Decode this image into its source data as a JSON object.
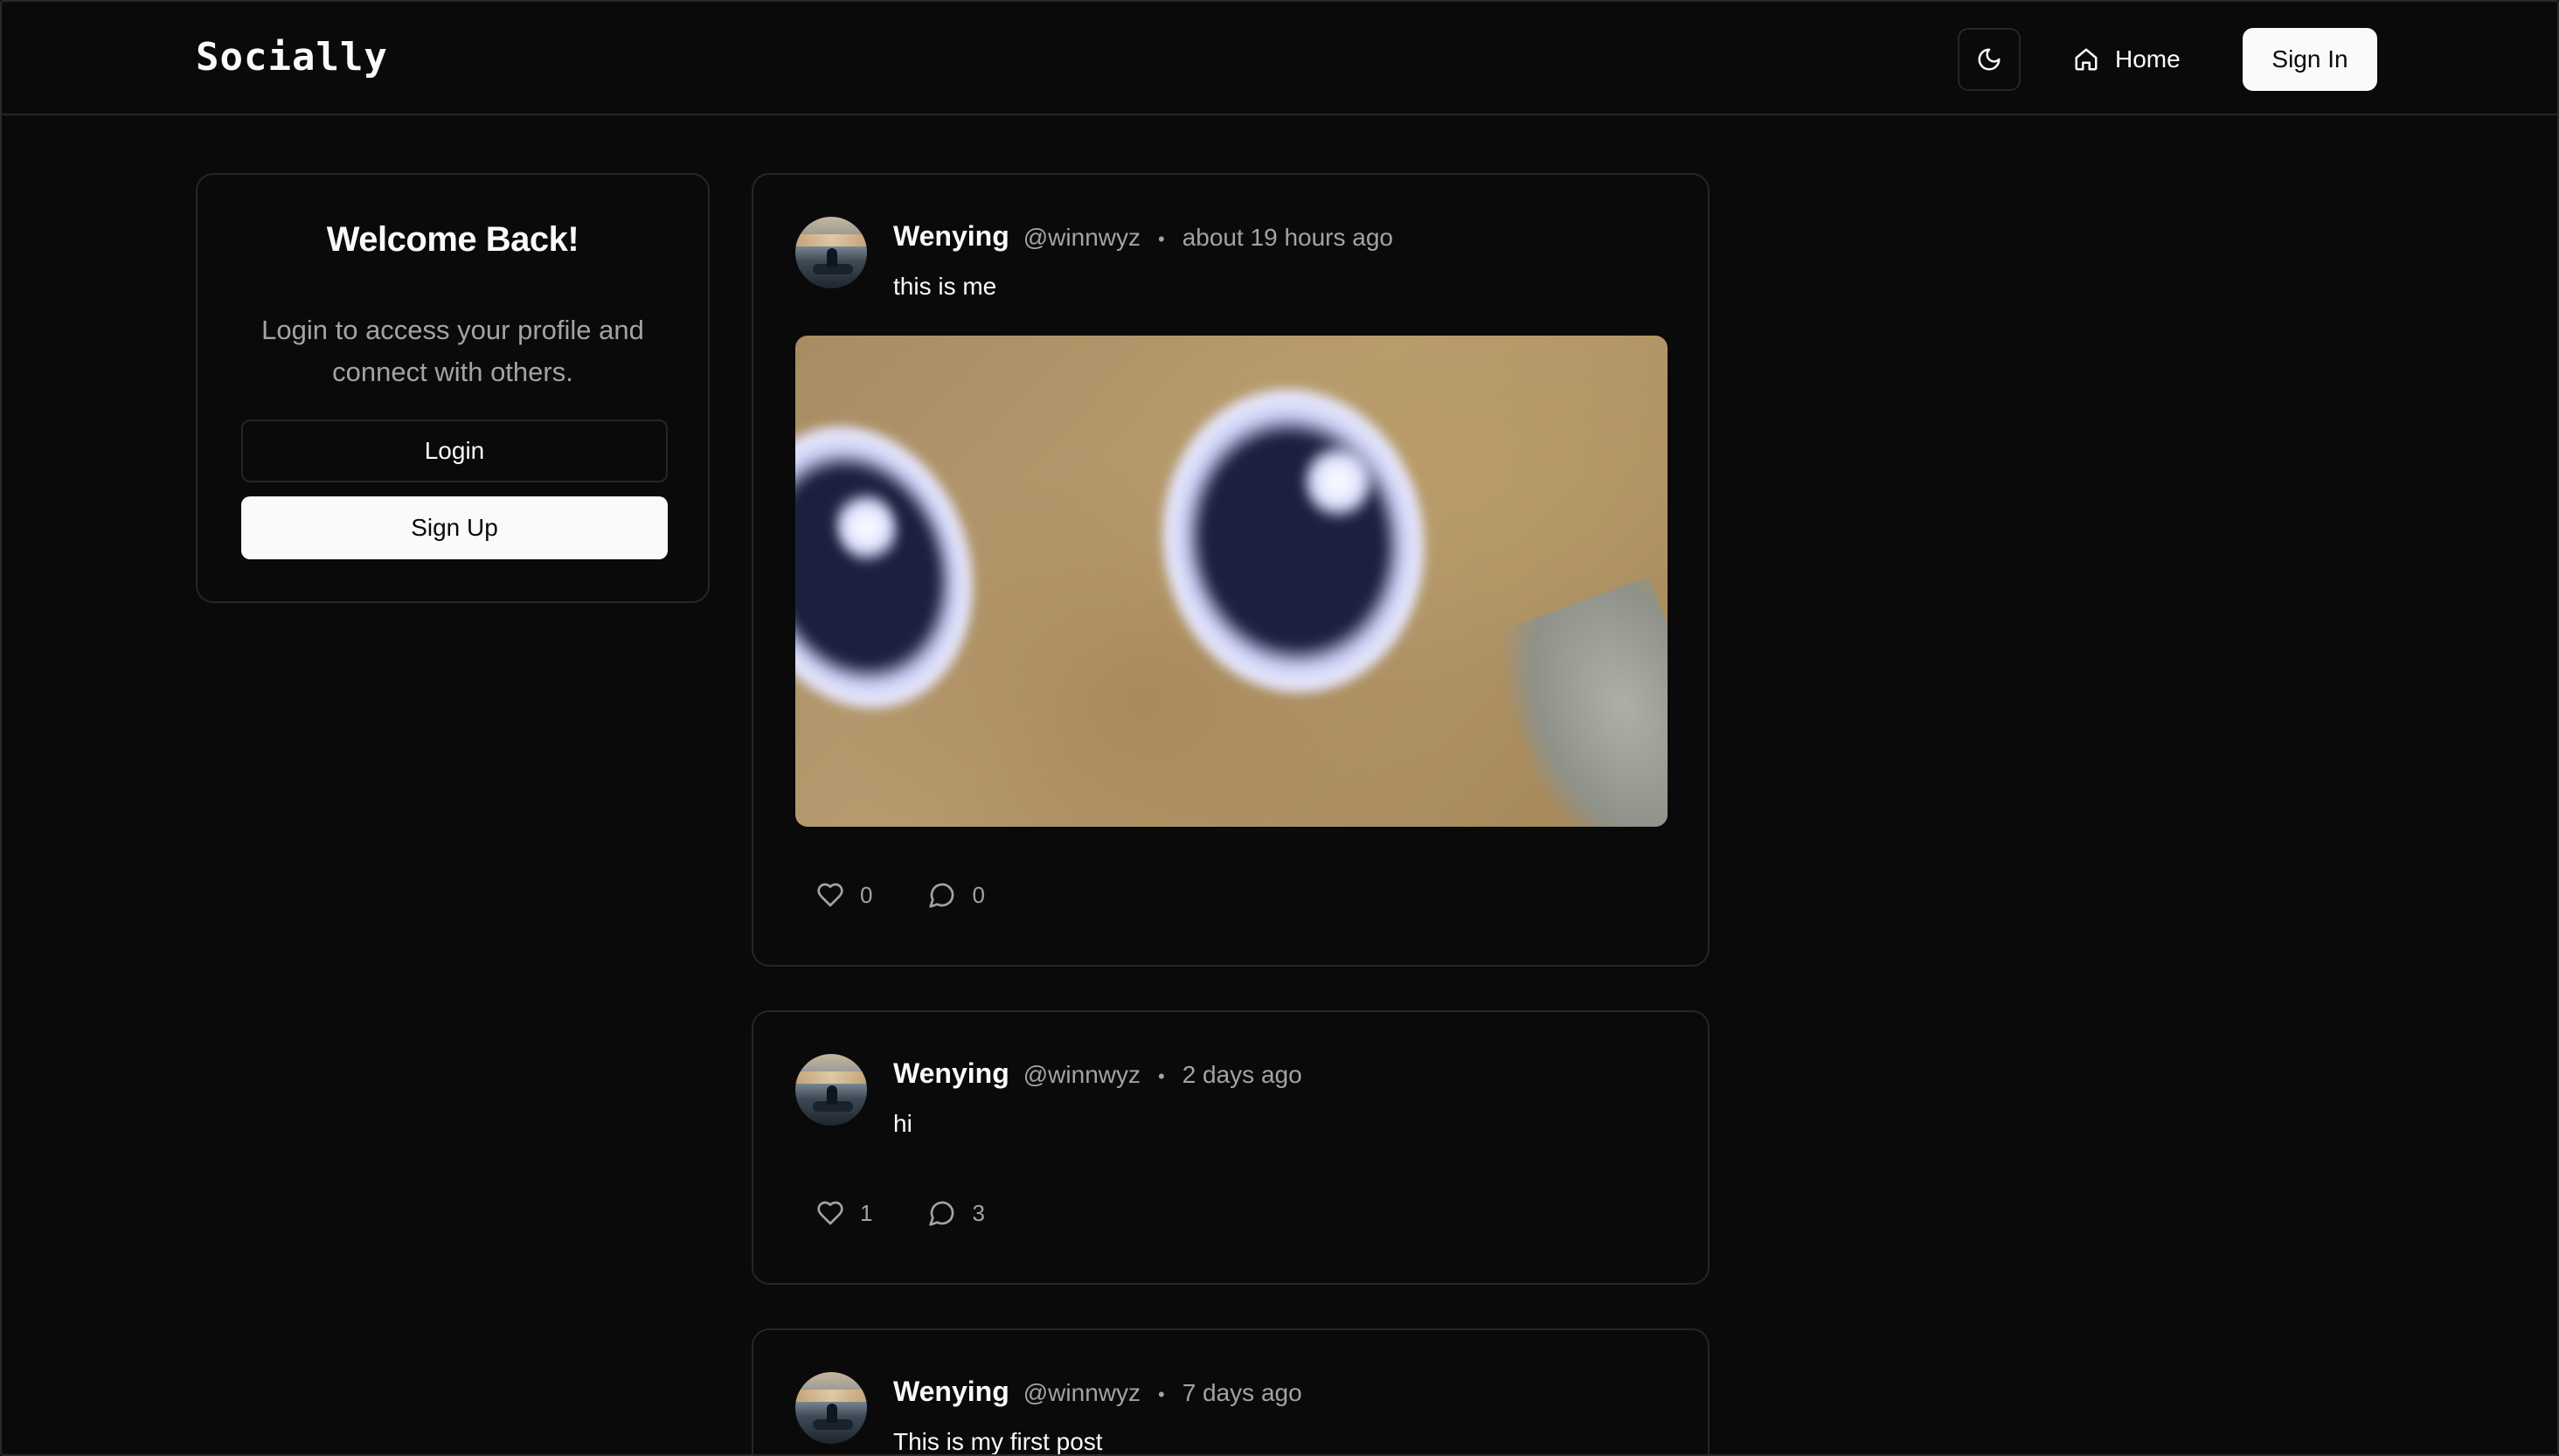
{
  "navbar": {
    "brand": "Socially",
    "theme_icon": "moon-icon",
    "home_label": "Home",
    "home_icon": "home-icon",
    "signin_label": "Sign In"
  },
  "welcome": {
    "title": "Welcome Back!",
    "description": "Login to access your profile and connect with others.",
    "login_label": "Login",
    "signup_label": "Sign Up"
  },
  "posts": [
    {
      "author": "Wenying",
      "handle": "@winnwyz",
      "separator": "•",
      "time": "about 19 hours ago",
      "text": "this is me",
      "has_image": true,
      "likes": "0",
      "comments": "0"
    },
    {
      "author": "Wenying",
      "handle": "@winnwyz",
      "separator": "•",
      "time": "2 days ago",
      "text": "hi",
      "has_image": false,
      "likes": "1",
      "comments": "3"
    },
    {
      "author": "Wenying",
      "handle": "@winnwyz",
      "separator": "•",
      "time": "7 days ago",
      "text": "This is my first post",
      "has_image": false
    }
  ],
  "colors": {
    "background": "#0a0a0a",
    "border": "#262626",
    "text": "#fafafa",
    "muted": "#a3a3a3"
  }
}
